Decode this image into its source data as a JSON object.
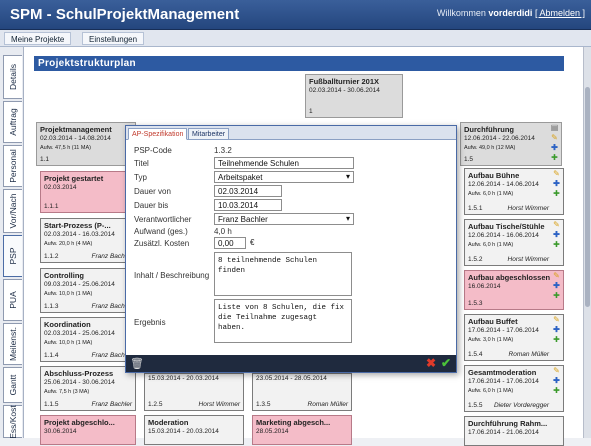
{
  "header": {
    "app_title": "SPM - SchulProjektManagement",
    "welcome": "Willkommen",
    "user": "vorderdidi",
    "logout": "[ Abmelden ]"
  },
  "nav": {
    "tabs": [
      "Meine Projekte",
      "Einstellungen"
    ]
  },
  "side_tabs": [
    "Details",
    "Auftrag",
    "Personal",
    "Vor/Nach",
    "PSP",
    "PUA",
    "Meilenst.",
    "Gantt",
    "Ess/Kost"
  ],
  "page_title": "Projektstrukturplan",
  "root": {
    "title": "Fußballturnier 201X",
    "dates": "02.03.2014 - 30.06.2014",
    "code": "1"
  },
  "nodes": {
    "pm": {
      "title": "Projektmanagement",
      "dates": "02.03.2014 - 14.08.2014",
      "effort": "Aufw. 47,5 h (11 MA)",
      "code": "1.1"
    },
    "pstart": {
      "title": "Projekt gestartet",
      "dates": "02.03.2014",
      "code": "1.1.1"
    },
    "start": {
      "title": "Start-Prozess (P-...",
      "dates": "02.03.2014 - 16.03.2014",
      "effort": "Aufw. 20,0 h (4 MA)",
      "code": "1.1.2",
      "person": "Franz Bachler"
    },
    "control": {
      "title": "Controlling",
      "dates": "09.03.2014 - 25.06.2014",
      "effort": "Aufw. 10,0 h (1 MA)",
      "code": "1.1.3",
      "person": "Franz Bachler"
    },
    "koord": {
      "title": "Koordination",
      "dates": "02.03.2014 - 25.06.2014",
      "effort": "Aufw. 10,0 h (1 MA)",
      "code": "1.1.4",
      "person": "Franz Bachler"
    },
    "abschluss": {
      "title": "Abschluss-Prozess",
      "dates": "25.06.2014 - 30.06.2014",
      "effort": "Aufw. 7,5 h (3 MA)",
      "code": "1.1.5",
      "person": "Franz Bachler"
    },
    "pabgesch": {
      "title": "Projekt abgeschlo...",
      "dates": "30.06.2014"
    },
    "durch": {
      "title": "Durchführung",
      "dates": "12.06.2014 - 22.06.2014",
      "effort": "Aufw. 49,0 h (12 MA)",
      "code": "1.5"
    },
    "buehne": {
      "title": "Aufbau Bühne",
      "dates": "12.06.2014 - 14.06.2014",
      "effort": "Aufw. 6,0 h (1 MA)",
      "code": "1.5.1",
      "person": "Horst Wimmer"
    },
    "tische": {
      "title": "Aufbau Tische/Stühle",
      "dates": "12.06.2014 - 16.06.2014",
      "effort": "Aufw. 6,0 h (1 MA)",
      "code": "1.5.2",
      "person": "Horst Wimmer"
    },
    "aufbauab": {
      "title": "Aufbau abgeschlossen",
      "dates": "16.06.2014",
      "code": "1.5.3"
    },
    "buffet": {
      "title": "Aufbau Buffet",
      "dates": "17.06.2014 - 17.06.2014",
      "effort": "Aufw. 3,0 h (1 MA)",
      "code": "1.5.4",
      "person": "Roman Müller"
    },
    "gesamt": {
      "title": "Gesamtmoderation",
      "dates": "17.06.2014 - 17.06.2014",
      "effort": "Aufw. 6,0 h (1 MA)",
      "code": "1.5.5",
      "person": "Dieter Vorderegger"
    },
    "rahmen": {
      "title": "Durchführung Rahm...",
      "dates": "17.06.2014 - 21.06.2014"
    },
    "mid1": {
      "dates": "15.03.2014 - 20.03.2014",
      "code": "1.2.5",
      "person": "Horst Wimmer"
    },
    "moder": {
      "title": "Moderation",
      "dates": "15.03.2014 - 20.03.2014"
    },
    "mid2": {
      "dates": "23.05.2014 - 28.05.2014",
      "code": "1.3.5",
      "person": "Roman Müller"
    },
    "marketing": {
      "title": "Marketing abgesch...",
      "dates": "28.05.2014"
    }
  },
  "dialog": {
    "tabs": [
      "AP-Spezifikation",
      "Mitarbeiter"
    ],
    "psp_label": "PSP-Code",
    "psp_value": "1.3.2",
    "title_label": "Titel",
    "title_value": "Teilnehmende Schulen",
    "typ_label": "Typ",
    "typ_value": "Arbeitspaket",
    "von_label": "Dauer von",
    "von_value": "02.03.2014",
    "bis_label": "Dauer bis",
    "bis_value": "10.03.2014",
    "resp_label": "Verantwortlicher",
    "resp_value": "Franz Bachler",
    "aufwand_label": "Aufwand (ges.)",
    "aufwand_value": "4,0 h",
    "kosten_label": "Zusätzl. Kosten",
    "kosten_value": "0,00",
    "currency": "€",
    "inhalt_label": "Inhalt / Beschreibung",
    "inhalt_value": "8 teilnehmende Schulen finden",
    "ergebnis_label": "Ergebnis",
    "ergebnis_value": "Liste von 8 Schulen, die fix die Teilnahme zugesagt haben."
  },
  "colors": {
    "header": "#2d5aa2",
    "milestone": "#f4bcc8",
    "dialog_footer": "#1f2a3e"
  }
}
